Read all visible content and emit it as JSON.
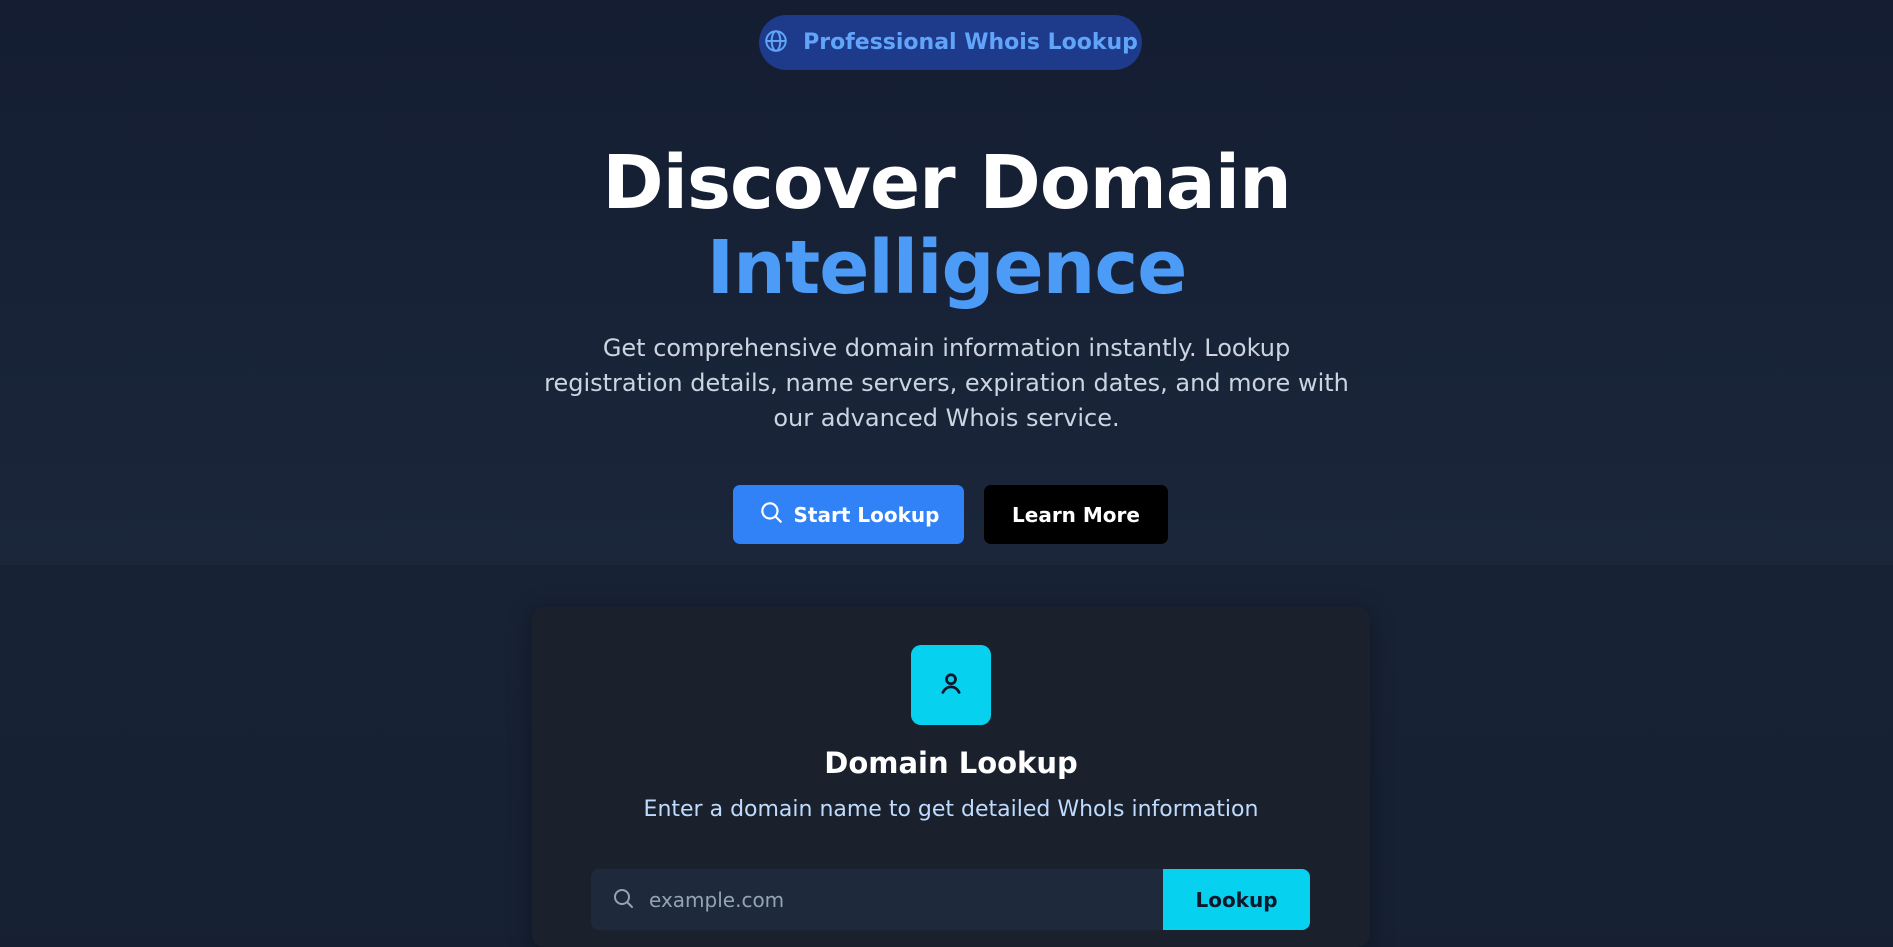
{
  "badge": {
    "icon": "globe-icon",
    "label": "Professional Whois Lookup"
  },
  "hero": {
    "title_line1": "Discover Domain",
    "title_line2": "Intelligence",
    "subtitle": "Get comprehensive domain information instantly. Lookup registration details, name servers, expiration dates, and more with our advanced Whois service.",
    "primary_button": {
      "icon": "search-icon",
      "label": "Start Lookup"
    },
    "secondary_button": {
      "label": "Learn More"
    }
  },
  "lookup_card": {
    "icon": "user-icon",
    "title": "Domain Lookup",
    "subtitle": "Enter a domain name to get detailed WhoIs information",
    "search": {
      "placeholder": "example.com",
      "value": ""
    },
    "submit_label": "Lookup"
  },
  "colors": {
    "accent_blue": "#3182f6",
    "title_highlight": "#4b9bf7",
    "accent_cyan": "#06d1ee",
    "badge_bg": "#1e3a8a"
  }
}
